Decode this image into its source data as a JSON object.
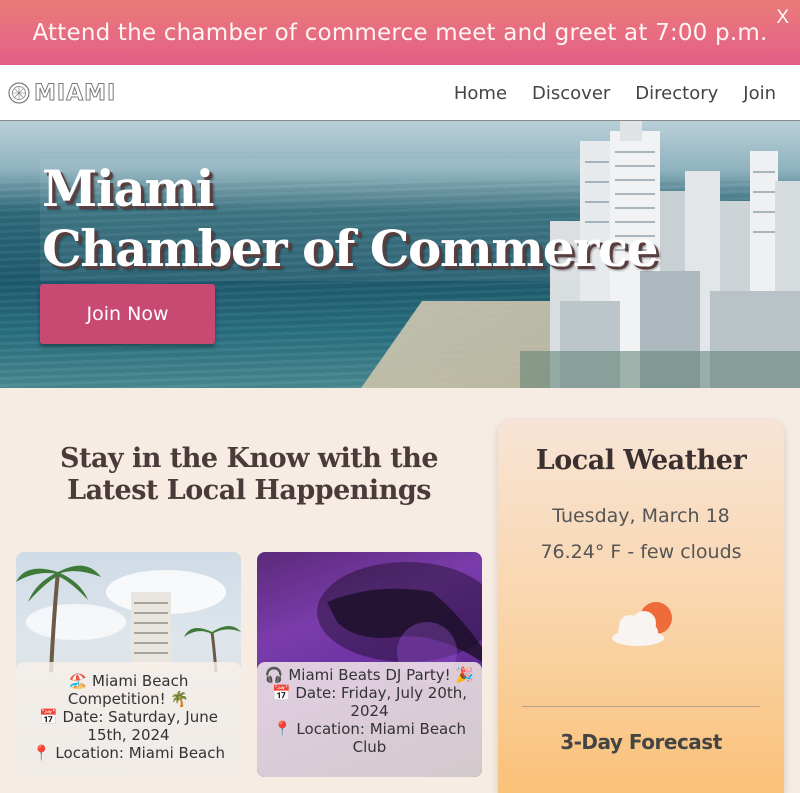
{
  "banner": {
    "text": "Attend the chamber of commerce meet and greet at 7:00 p.m.",
    "close_label": "X"
  },
  "nav": {
    "logo_text": "MIAMI",
    "links": [
      "Home",
      "Discover",
      "Directory",
      "Join"
    ]
  },
  "hero": {
    "title_line1": "Miami",
    "title_line2": "Chamber of Commerce",
    "cta_label": "Join Now"
  },
  "happenings": {
    "title": "Stay in the Know with the Latest Local Happenings",
    "events": [
      {
        "name": "🏖️ Miami Beach Competition! 🌴",
        "date": "📅 Date: Saturday, June 15th, 2024",
        "location": "📍 Location: Miami Beach"
      },
      {
        "name": "🎧 Miami Beats DJ Party! 🎉",
        "date": "📅 Date: Friday, July 20th, 2024",
        "location": "📍 Location: Miami Beach Club"
      }
    ]
  },
  "weather": {
    "title": "Local Weather",
    "date": "Tuesday, March 18",
    "temperature": "76.24° F - few clouds",
    "icon": "few-clouds-icon",
    "forecast_title": "3-Day Forecast"
  },
  "colors": {
    "banner_top": "#ea7b78",
    "banner_bottom": "#e45f88",
    "cta": "#c84a72",
    "page_bg": "#f6ece4"
  }
}
